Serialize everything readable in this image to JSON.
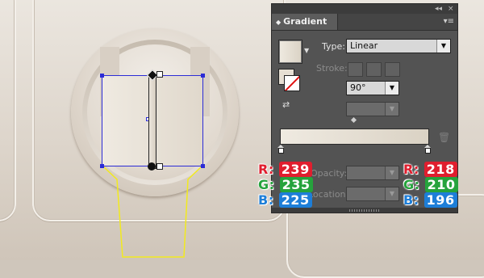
{
  "panel": {
    "title": "Gradient",
    "collapse_control": "◂◂",
    "close_control": "×",
    "menu_icon": "hamburger-menu-icon",
    "type_label": "Type:",
    "type_value": "Linear",
    "stroke_label": "Stroke:",
    "angle_value": "90°",
    "opacity_label": "Opacity:",
    "location_label": "Location:"
  },
  "colors": {
    "gradient_start": "#efeae1",
    "gradient_end": "#dad2c4",
    "selection_blue": "#2c2cd6",
    "yellow_path": "#f2ea1e",
    "red_channel": "#e01e2e",
    "green_channel": "#25a33c",
    "blue_channel": "#1d7ed8"
  },
  "left_color": {
    "r_label": "R:",
    "r_value": "239",
    "g_label": "G:",
    "g_value": "235",
    "b_label": "B:",
    "b_value": "225"
  },
  "right_color": {
    "r_label": "R:",
    "r_value": "218",
    "g_label": "G:",
    "g_value": "210",
    "b_label": "B:",
    "b_value": "196"
  }
}
